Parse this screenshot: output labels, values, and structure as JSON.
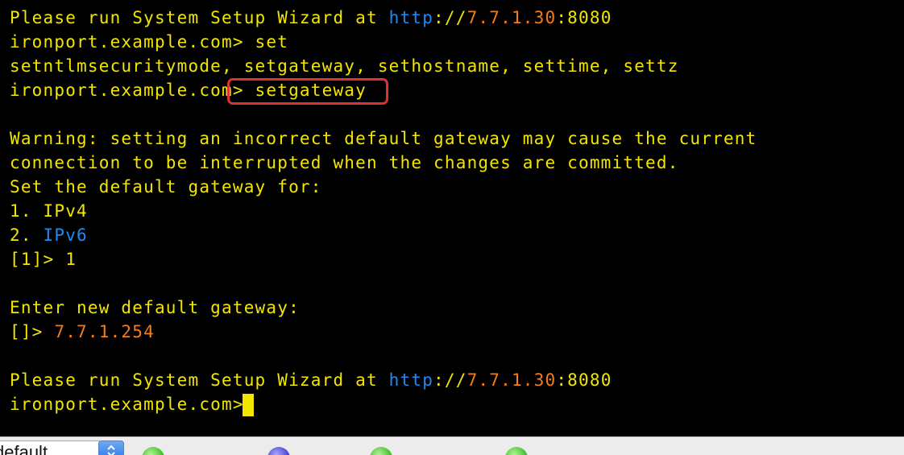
{
  "terminal": {
    "lines": [
      [
        {
          "text": "Please run System Setup Wizard at ",
          "color": "yellow"
        },
        {
          "text": "http",
          "color": "blue"
        },
        {
          "text": "://",
          "color": "yellow"
        },
        {
          "text": "7.7.1.30",
          "color": "orange"
        },
        {
          "text": ":8080",
          "color": "yellow"
        }
      ],
      [
        {
          "text": "ironport.example.com> set",
          "color": "yellow"
        }
      ],
      [
        {
          "text": "setntlmsecuritymode, setgateway, sethostname, settime, settz",
          "color": "yellow"
        }
      ],
      [
        {
          "text": "ironport.example.com> setgateway",
          "color": "yellow"
        }
      ],
      [
        {
          "text": "",
          "color": "yellow"
        }
      ],
      [
        {
          "text": "Warning: setting an incorrect default gateway may cause the current",
          "color": "yellow"
        }
      ],
      [
        {
          "text": "connection to be interrupted when the changes are committed.",
          "color": "yellow"
        }
      ],
      [
        {
          "text": "Set the default gateway for:",
          "color": "yellow"
        }
      ],
      [
        {
          "text": "1. IPv4",
          "color": "yellow"
        }
      ],
      [
        {
          "text": "2. ",
          "color": "yellow"
        },
        {
          "text": "IPv6",
          "color": "blue"
        }
      ],
      [
        {
          "text": "[1]> 1",
          "color": "yellow"
        }
      ],
      [
        {
          "text": "",
          "color": "yellow"
        }
      ],
      [
        {
          "text": "Enter new default gateway:",
          "color": "yellow"
        }
      ],
      [
        {
          "text": "[]> ",
          "color": "yellow"
        },
        {
          "text": "7.7.1.254",
          "color": "orange"
        }
      ],
      [
        {
          "text": "",
          "color": "yellow"
        }
      ],
      [
        {
          "text": "Please run System Setup Wizard at ",
          "color": "yellow"
        },
        {
          "text": "http",
          "color": "blue"
        },
        {
          "text": "://",
          "color": "yellow"
        },
        {
          "text": "7.7.1.30",
          "color": "orange"
        },
        {
          "text": ":8080",
          "color": "yellow"
        }
      ],
      [
        {
          "text": "ironport.example.com> ",
          "color": "yellow"
        }
      ]
    ],
    "colors": {
      "background": "#000000",
      "yellow": "#f2e600",
      "blue": "#1e8bf0",
      "orange": "#f47c1a",
      "highlight_box": "#e0322d"
    },
    "highlighted_command": "setgateway",
    "cursor_icon": "block-cursor"
  },
  "bottom_bar": {
    "select_value": "default",
    "stepper_icon": "up-down-chevron-icon",
    "status_items": [
      {
        "icon": "green-dot-icon"
      },
      {
        "icon": "blue-dot-icon"
      },
      {
        "icon": "green-dot-icon"
      },
      {
        "icon": "green-dot-icon"
      }
    ]
  }
}
